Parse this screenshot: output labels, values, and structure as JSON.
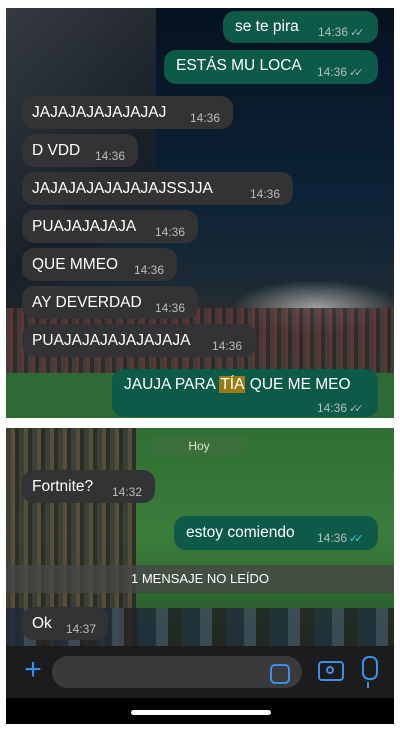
{
  "top_messages": [
    {
      "text": "se te pira",
      "time": "14:36",
      "dir": "out",
      "ticks": "✓✓"
    },
    {
      "text": "ESTÁS MU LOCA",
      "time": "14:36",
      "dir": "out",
      "ticks": "✓✓"
    },
    {
      "text": "JAJAJAJAJAJAJAJ",
      "time": "14:36",
      "dir": "in"
    },
    {
      "text": "D VDD",
      "time": "14:36",
      "dir": "in"
    },
    {
      "text": "JAJAJAJAJAJAJAJSSJJA",
      "time": "14:36",
      "dir": "in"
    },
    {
      "text": "PUAJAJAJAJA",
      "time": "14:36",
      "dir": "in"
    },
    {
      "text": "QUE MMEO",
      "time": "14:36",
      "dir": "in"
    },
    {
      "text": "AY DEVERDAD",
      "time": "14:36",
      "dir": "in"
    },
    {
      "text": "PUAJAJAJAJAJAJAJA",
      "time": "14:36",
      "dir": "in"
    },
    {
      "text_before": "JAUJA PARA ",
      "text_highlight": "TÍA",
      "text_after": " QUE ME MEO",
      "time": "14:36",
      "dir": "out",
      "ticks": "✓✓"
    }
  ],
  "day_label": "Hoy",
  "bottom_messages": [
    {
      "text": "Fortnite?",
      "time": "14:32",
      "dir": "in"
    },
    {
      "text": "estoy comiendo",
      "time": "14:36",
      "dir": "out",
      "ticks": "✓✓",
      "read": true
    }
  ],
  "unread_banner": "1 MENSAJE NO LEÍDO",
  "last_message": {
    "text": "Ok",
    "time": "14:37",
    "dir": "in"
  },
  "input_bar": {
    "icons": [
      "plus-icon",
      "sticker-icon",
      "camera-icon",
      "microphone-icon"
    ],
    "plus_glyph": "+",
    "accent_color": "#3a8fe8"
  },
  "colors": {
    "incoming_bubble": "#333336",
    "outgoing_bubble": "#0e5a48",
    "read_ticks": "#53bdeb",
    "highlight": "#9c7a14"
  }
}
